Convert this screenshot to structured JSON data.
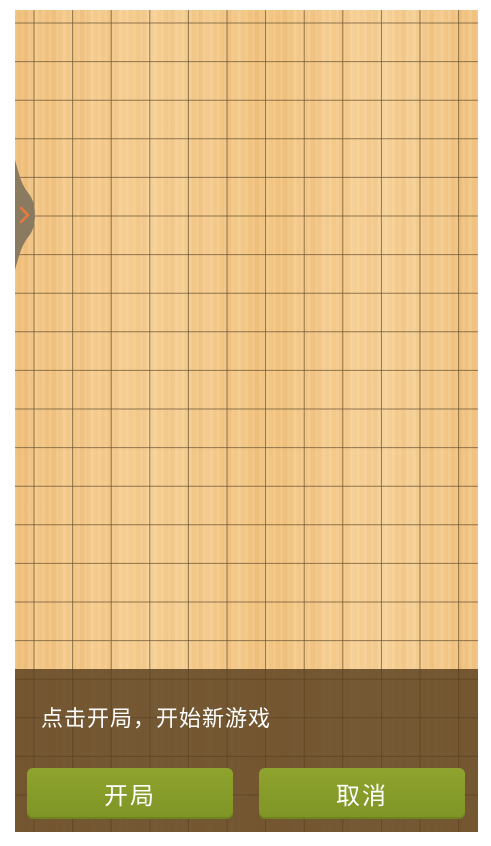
{
  "board": {
    "columns": 12,
    "rows": 22,
    "line_color": "#6b5534",
    "wood_color": "#f5c886"
  },
  "drawer_handle": {
    "icon": "chevron-right-icon",
    "color": "#8a7a60",
    "accent": "#e87a3c"
  },
  "dialog": {
    "prompt": "点击开局，开始新游戏",
    "start_label": "开局",
    "cancel_label": "取消",
    "panel_color": "#583e1e",
    "button_color": "#869c29"
  }
}
